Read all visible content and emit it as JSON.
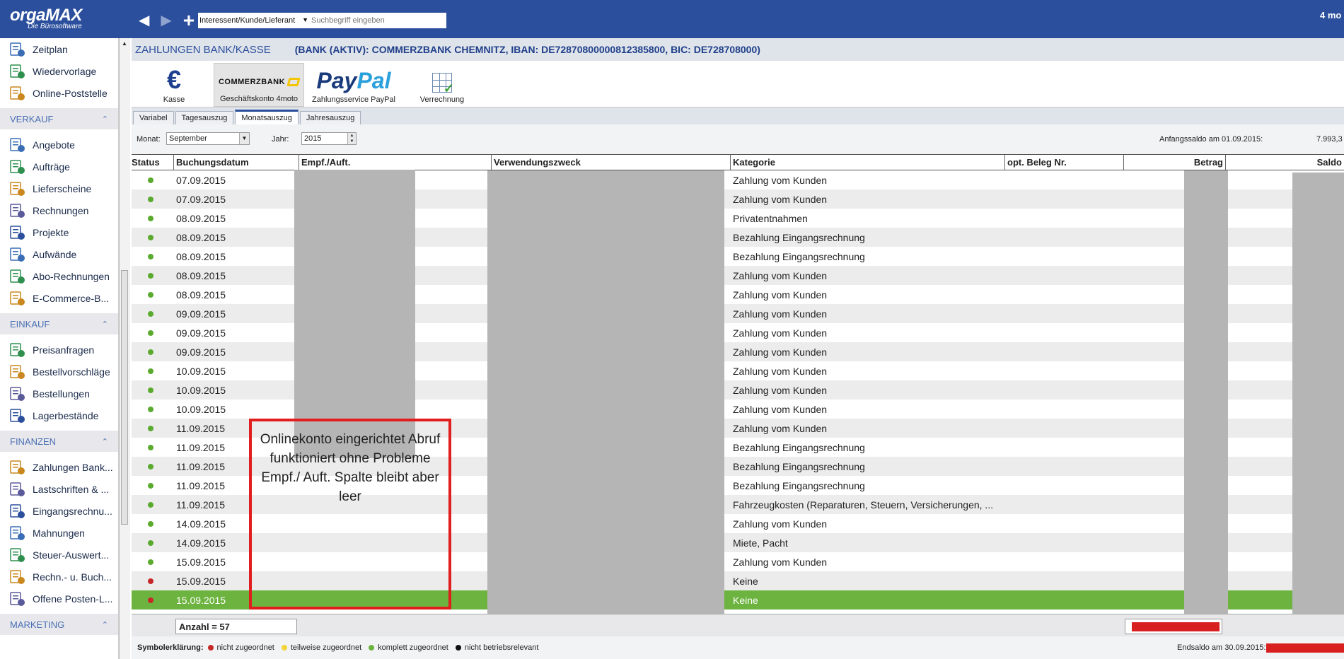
{
  "app": {
    "logo_text": "orgaMAX",
    "logo_sub": "Die Bürosoftware",
    "top_right_text": "4 mo",
    "search": {
      "type": "Interessent/Kunde/Lieferant",
      "placeholder": "Suchbegriff eingeben"
    }
  },
  "sidebar": {
    "top_items": [
      {
        "label": "Zeitplan",
        "icon": "calendar-clock-icon"
      },
      {
        "label": "Wiedervorlage",
        "icon": "resubmission-icon"
      },
      {
        "label": "Online-Poststelle",
        "icon": "globe-icon"
      }
    ],
    "sections": [
      {
        "title": "VERKAUF",
        "items": [
          "Angebote",
          "Aufträge",
          "Lieferscheine",
          "Rechnungen",
          "Projekte",
          "Aufwände",
          "Abo-Rechnungen",
          "E-Commerce-B..."
        ]
      },
      {
        "title": "EINKAUF",
        "items": [
          "Preisanfragen",
          "Bestellvorschläge",
          "Bestellungen",
          "Lagerbestände"
        ]
      },
      {
        "title": "FINANZEN",
        "items": [
          "Zahlungen Bank...",
          "Lastschriften & ...",
          "Eingangsrechnu...",
          "Mahnungen",
          "Steuer-Auswert...",
          "Rechn.- u. Buch...",
          "Offene Posten-L..."
        ]
      },
      {
        "title": "MARKETING",
        "items": []
      }
    ]
  },
  "header": {
    "title": "ZAHLUNGEN BANK/KASSE",
    "bank_info": "(BANK (AKTIV): COMMERZBANK CHEMNITZ, IBAN: DE72870800000812385800, BIC: DE728708000)"
  },
  "accounts": [
    {
      "label": "Kasse",
      "icon": "euro-icon"
    },
    {
      "label": "Geschäftskonto 4moto",
      "logo_text": "COMMERZBANK",
      "icon": "commerzbank-logo"
    },
    {
      "label": "Zahlungsservice PayPal",
      "logo_text_1": "Pay",
      "logo_text_2": "Pal",
      "icon": "paypal-logo"
    },
    {
      "label": "Verrechnung",
      "icon": "table-check-icon"
    }
  ],
  "tabs": [
    "Variabel",
    "Tagesauszug",
    "Monatsauszug",
    "Jahresauszug"
  ],
  "active_tab": "Monatsauszug",
  "filter": {
    "monat_label": "Monat:",
    "monat_value": "September",
    "jahr_label": "Jahr:",
    "jahr_value": "2015",
    "anfangssaldo_label": "Anfangssaldo am 01.09.2015:",
    "anfangssaldo_value": "7.993,3"
  },
  "table": {
    "columns": [
      "Status",
      "Buchungsdatum",
      "Empf./Auft.",
      "Verwendungszweck",
      "Kategorie",
      "opt. Beleg Nr.",
      "Betrag",
      "Saldo"
    ],
    "rows": [
      {
        "status": "green",
        "date": "07.09.2015",
        "kategorie": "Zahlung vom Kunden"
      },
      {
        "status": "green",
        "date": "07.09.2015",
        "kategorie": "Zahlung vom Kunden"
      },
      {
        "status": "green",
        "date": "08.09.2015",
        "kategorie": "Privatentnahmen"
      },
      {
        "status": "green",
        "date": "08.09.2015",
        "kategorie": "Bezahlung Eingangsrechnung"
      },
      {
        "status": "green",
        "date": "08.09.2015",
        "kategorie": "Bezahlung Eingangsrechnung"
      },
      {
        "status": "green",
        "date": "08.09.2015",
        "kategorie": "Zahlung vom Kunden"
      },
      {
        "status": "green",
        "date": "08.09.2015",
        "kategorie": "Zahlung vom Kunden"
      },
      {
        "status": "green",
        "date": "09.09.2015",
        "kategorie": "Zahlung vom Kunden"
      },
      {
        "status": "green",
        "date": "09.09.2015",
        "kategorie": "Zahlung vom Kunden"
      },
      {
        "status": "green",
        "date": "09.09.2015",
        "kategorie": "Zahlung vom Kunden"
      },
      {
        "status": "green",
        "date": "10.09.2015",
        "kategorie": "Zahlung vom Kunden"
      },
      {
        "status": "green",
        "date": "10.09.2015",
        "kategorie": "Zahlung vom Kunden"
      },
      {
        "status": "green",
        "date": "10.09.2015",
        "kategorie": "Zahlung vom Kunden"
      },
      {
        "status": "green",
        "date": "11.09.2015",
        "kategorie": "Zahlung vom Kunden"
      },
      {
        "status": "green",
        "date": "11.09.2015",
        "kategorie": "Bezahlung Eingangsrechnung"
      },
      {
        "status": "green",
        "date": "11.09.2015",
        "kategorie": "Bezahlung Eingangsrechnung"
      },
      {
        "status": "green",
        "date": "11.09.2015",
        "kategorie": "Bezahlung Eingangsrechnung"
      },
      {
        "status": "green",
        "date": "11.09.2015",
        "kategorie": "Fahrzeugkosten (Reparaturen, Steuern, Versicherungen, ..."
      },
      {
        "status": "green",
        "date": "14.09.2015",
        "kategorie": "Zahlung vom Kunden"
      },
      {
        "status": "green",
        "date": "14.09.2015",
        "kategorie": "Miete, Pacht"
      },
      {
        "status": "green",
        "date": "15.09.2015",
        "kategorie": "Zahlung vom Kunden"
      },
      {
        "status": "red",
        "date": "15.09.2015",
        "kategorie": "Keine"
      },
      {
        "status": "red",
        "date": "15.09.2015",
        "kategorie": "Keine",
        "selected": true
      }
    ]
  },
  "annotation": {
    "line1": "Onlinekonto eingerichtet Abruf",
    "line2": "funktioniert ohne Probleme",
    "line3": "Empf./ Auft. Spalte bleibt aber leer"
  },
  "footer": {
    "count": "Anzahl = 57",
    "legend_title": "Symbolerklärung:",
    "legend": [
      {
        "label": "nicht zugeordnet",
        "color": "#c62828"
      },
      {
        "label": "teilweise zugeordnet",
        "color": "#f2d43a"
      },
      {
        "label": "komplett zugeordnet",
        "color": "#6db33f"
      },
      {
        "label": "nicht betriebsrelevant",
        "color": "#111111"
      }
    ],
    "endsaldo_label": "Endsaldo am 30.09.2015:"
  },
  "colors": {
    "brand": "#2b4f9c",
    "selected_row": "#6db33f",
    "status_green": "#5aaa2e",
    "status_red": "#c62828",
    "annotation": "#e01e1e"
  }
}
